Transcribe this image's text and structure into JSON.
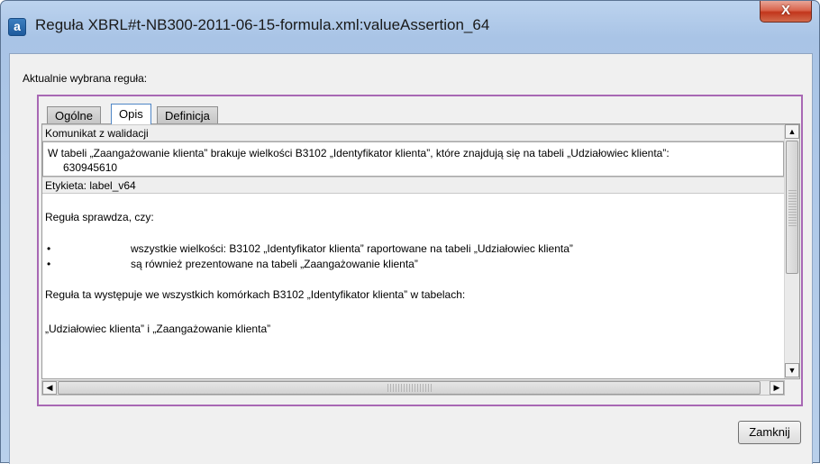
{
  "window": {
    "icon_letter": "a",
    "title": "Reguła XBRL#t-NB300-2011-06-15-formula.xml:valueAssertion_64",
    "close_glyph": "X"
  },
  "dialog": {
    "current_rule_label": "Aktualnie wybrana reguła:",
    "tabs": [
      {
        "label": "Ogólne",
        "active": false
      },
      {
        "label": "Opis",
        "active": true
      },
      {
        "label": "Definicja",
        "active": false
      }
    ],
    "validation_header": "Komunikat z walidacji",
    "validation_message_line1": "W tabeli „Zaangażowanie klienta” brakuje wielkości B3102 „Identyfikator klienta”, które znajdują się na tabeli „Udziałowiec klienta”:",
    "validation_message_line2": "630945610",
    "label_header": "Etykieta: label_v64",
    "description": {
      "intro": "Reguła sprawdza, czy:",
      "bullet_char": "•",
      "bullets": [
        "wszystkie wielkości: B3102 „Identyfikator klienta” raportowane na tabeli „Udziałowiec klienta”",
        "są również prezentowane na tabeli „Zaangażowanie klienta”"
      ],
      "occurs": "Reguła ta występuje we wszystkich komórkach B3102 „Identyfikator klienta” w tabelach:",
      "tables": "„Udziałowiec klienta” i „Zaangażowanie klienta”"
    },
    "scroll_arrows": {
      "up": "▲",
      "down": "▼",
      "left": "◀",
      "right": "▶"
    },
    "close_button_label": "Zamknij"
  }
}
